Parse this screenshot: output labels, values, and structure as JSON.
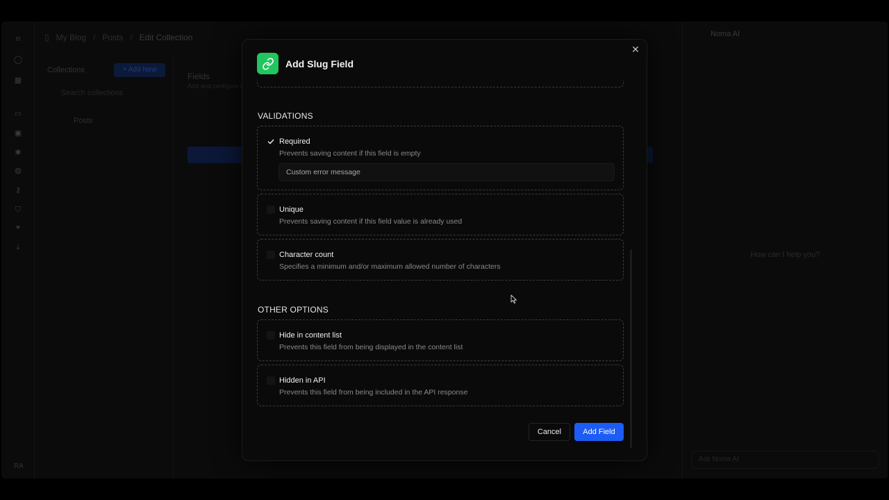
{
  "background": {
    "breadcrumbs": [
      "My Blog",
      "Posts",
      "Edit Collection"
    ],
    "collections_title": "Collections",
    "add_new_label": "+ Add New",
    "search_placeholder": "Search collections",
    "collection_item": "Posts",
    "fields_title": "Fields",
    "fields_subtitle": "Add and configure fields",
    "ai_title": "Noma AI",
    "ai_help": "How can I help you?",
    "ai_input_placeholder": "Ask Noma AI",
    "user_initials": "RA"
  },
  "modal": {
    "title": "Add Slug Field",
    "header_icon": "link-icon",
    "accent_color": "#22c55e",
    "validations_title": "VALIDATIONS",
    "other_options_title": "OTHER OPTIONS",
    "validations": [
      {
        "label": "Required",
        "description": "Prevents saving content if this field is empty",
        "checked": true,
        "error_placeholder": "Custom error message"
      },
      {
        "label": "Unique",
        "description": "Prevents saving content if this field value is already used",
        "checked": false
      },
      {
        "label": "Character count",
        "description": "Specifies a minimum and/or maximum allowed number of characters",
        "checked": false
      }
    ],
    "other_options": [
      {
        "label": "Hide in content list",
        "description": "Prevents this field from being displayed in the content list",
        "checked": false
      },
      {
        "label": "Hidden in API",
        "description": "Prevents this field from being included in the API response",
        "checked": false
      }
    ],
    "cancel_label": "Cancel",
    "add_label": "Add Field",
    "primary_color": "#1d5cf5"
  }
}
